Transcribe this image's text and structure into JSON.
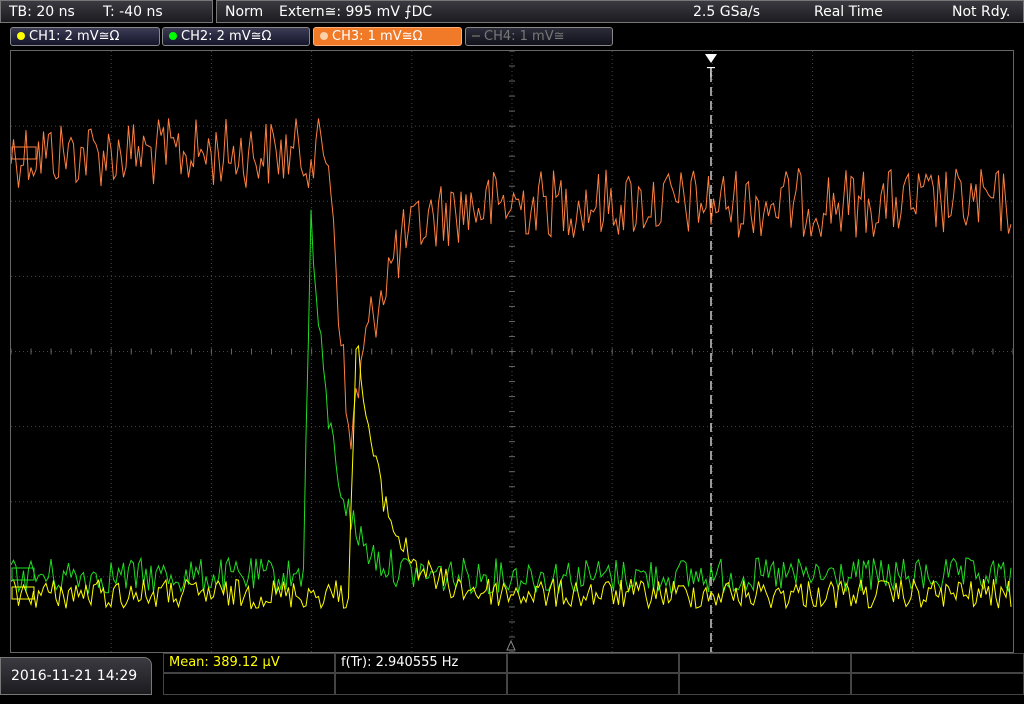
{
  "header": {
    "timebase": "TB: 20 ns",
    "trigger_offset": "T: -40 ns",
    "mode": "Norm",
    "trigger_source": "Extern≅: 995 mV ⨍DC",
    "sample_rate": "2.5 GSa/s",
    "acquisition": "Real Time",
    "status": "Not Rdy."
  },
  "channels": [
    {
      "label": "CH1: 2 mV≅Ω",
      "color": "#ffff00",
      "state": "on"
    },
    {
      "label": "CH2: 2 mV≅Ω",
      "color": "#00ff00",
      "state": "on"
    },
    {
      "label": "CH3: 1 mV≅Ω",
      "color": "#ff9955",
      "state": "selected"
    },
    {
      "label": "CH4: 1 mV≅",
      "color": "#666666",
      "state": "off"
    }
  ],
  "trigger_marker": "T",
  "footer": {
    "datetime": "2016-11-21 14:29",
    "mean": "Mean: 389.12 µV",
    "frequency": "f(Tr): 2.940555 Hz"
  },
  "colors": {
    "ch1": "#ffff00",
    "ch2": "#22dd22",
    "ch3": "#ff8040",
    "grid": "#444444",
    "trigger_line": "#ffffff"
  }
}
